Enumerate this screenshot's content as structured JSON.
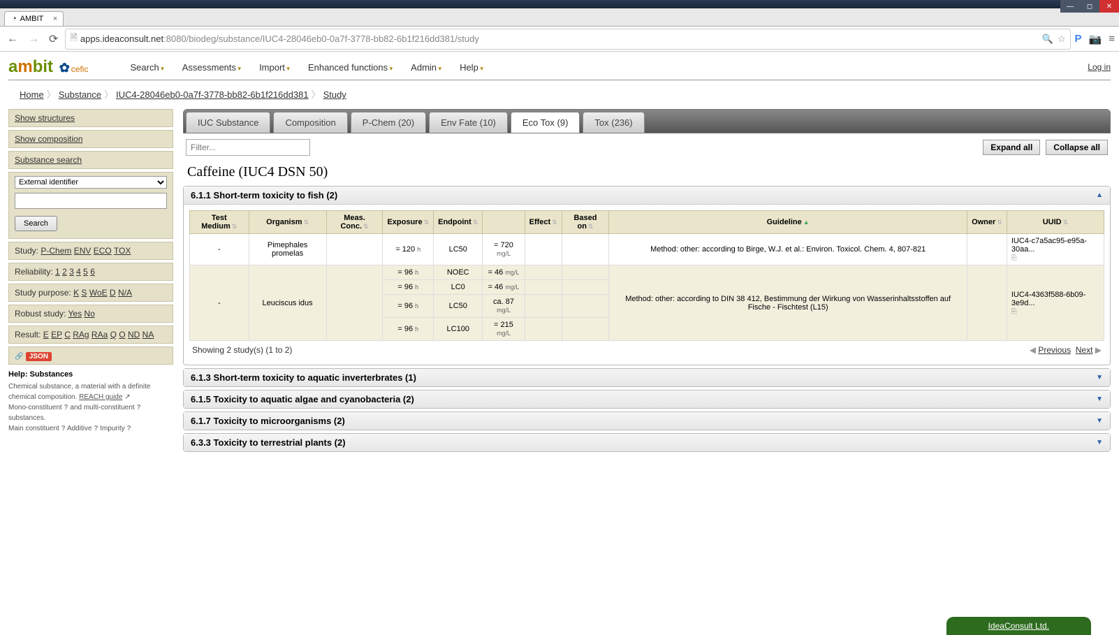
{
  "browser": {
    "tab_title": "AMBIT",
    "url_host_a": "apps.ideaconsult.net",
    "url_host_b": ":8080",
    "url_path": "/biodeg/substance/IUC4-28046eb0-0a7f-3778-bb82-6b1f216dd381/study"
  },
  "header": {
    "nav": [
      "Search",
      "Assessments",
      "Import",
      "Enhanced functions",
      "Admin",
      "Help"
    ],
    "login": "Log in"
  },
  "breadcrumb": [
    "Home",
    "Substance",
    "IUC4-28046eb0-0a7f-3778-bb82-6b1f216dd381",
    "Study"
  ],
  "sidebar": {
    "links": [
      "Show structures",
      "Show composition",
      "Substance search"
    ],
    "select_value": "External identifier",
    "search_btn": "Search",
    "study_label": "Study:",
    "study_links": [
      "P-Chem",
      "ENV",
      "ECO",
      "TOX"
    ],
    "reliability_label": "Reliability:",
    "reliability_links": [
      "1",
      "2",
      "3",
      "4",
      "5",
      "6"
    ],
    "purpose_label": "Study purpose:",
    "purpose_links": [
      "K",
      "S",
      "WoE",
      "D",
      "N/A"
    ],
    "robust_label": "Robust study:",
    "robust_links": [
      "Yes",
      "No"
    ],
    "result_label": "Result:",
    "result_links": [
      "E",
      "EP",
      "C",
      "RAg",
      "RAa",
      "Q",
      "O",
      "ND",
      "NA"
    ],
    "json": "JSON",
    "help_title": "Help: Substances",
    "help_text1": "Chemical substance, a material with a definite chemical composition.",
    "help_guide": "REACH guide",
    "help_text2a": "Mono-constituent",
    "help_text2b": "and multi-constituent",
    "help_text2c": "substances.",
    "help_text3a": "Main constituent",
    "help_text3b": "Additive",
    "help_text3c": "Impurity"
  },
  "tabs": [
    "IUC Substance",
    "Composition",
    "P-Chem (20)",
    "Env Fate (10)",
    "Eco Tox (9)",
    "Tox (236)"
  ],
  "active_tab": 4,
  "toolbar": {
    "filter_placeholder": "Filter...",
    "expand": "Expand all",
    "collapse": "Collapse all"
  },
  "title": "Caffeine (IUC4 DSN 50)",
  "section_open": {
    "header": "6.1.1 Short-term toxicity to fish (2)",
    "columns": [
      "Test Medium",
      "Organism",
      "Meas. Conc.",
      "Exposure",
      "Endpoint",
      "",
      "Effect",
      "Based on",
      "Guideline",
      "Owner",
      "UUID"
    ],
    "rows": [
      {
        "medium": "-",
        "organism": "Pimephales promelas",
        "subrows": [
          {
            "exposure": "= 120",
            "exp_unit": "h",
            "endpoint": "LC50",
            "value": "= 720",
            "val_unit": "mg/L"
          }
        ],
        "guideline": "Method: other: according to Birge, W.J. et al.: Environ. Toxicol. Chem. 4, 807-821",
        "uuid": "IUC4-c7a5ac95-e95a-30aa..."
      },
      {
        "medium": "-",
        "organism": "Leuciscus idus",
        "subrows": [
          {
            "exposure": "= 96",
            "exp_unit": "h",
            "endpoint": "NOEC",
            "value": "= 46",
            "val_unit": "mg/L"
          },
          {
            "exposure": "= 96",
            "exp_unit": "h",
            "endpoint": "LC0",
            "value": "= 46",
            "val_unit": "mg/L"
          },
          {
            "exposure": "= 96",
            "exp_unit": "h",
            "endpoint": "LC50",
            "value": "ca. 87",
            "val_unit": "mg/L"
          },
          {
            "exposure": "= 96",
            "exp_unit": "h",
            "endpoint": "LC100",
            "value": "= 215",
            "val_unit": "mg/L"
          }
        ],
        "guideline": "Method: other: according to DIN 38 412, Bestimmung der Wirkung von Wasserinhaltsstoffen auf Fische - Fischtest (L15)",
        "uuid": "IUC4-4363f588-6b09-3e9d..."
      }
    ],
    "footer_count": "Showing 2 study(s) (1 to 2)",
    "prev": "Previous",
    "next": "Next"
  },
  "sections_closed": [
    "6.1.3 Short-term toxicity to aquatic inverterbrates (1)",
    "6.1.5 Toxicity to aquatic algae and cyanobacteria (2)",
    "6.1.7 Toxicity to microorganisms (2)",
    "6.3.3 Toxicity to terrestrial plants (2)"
  ],
  "footer": "IdeaConsult Ltd."
}
